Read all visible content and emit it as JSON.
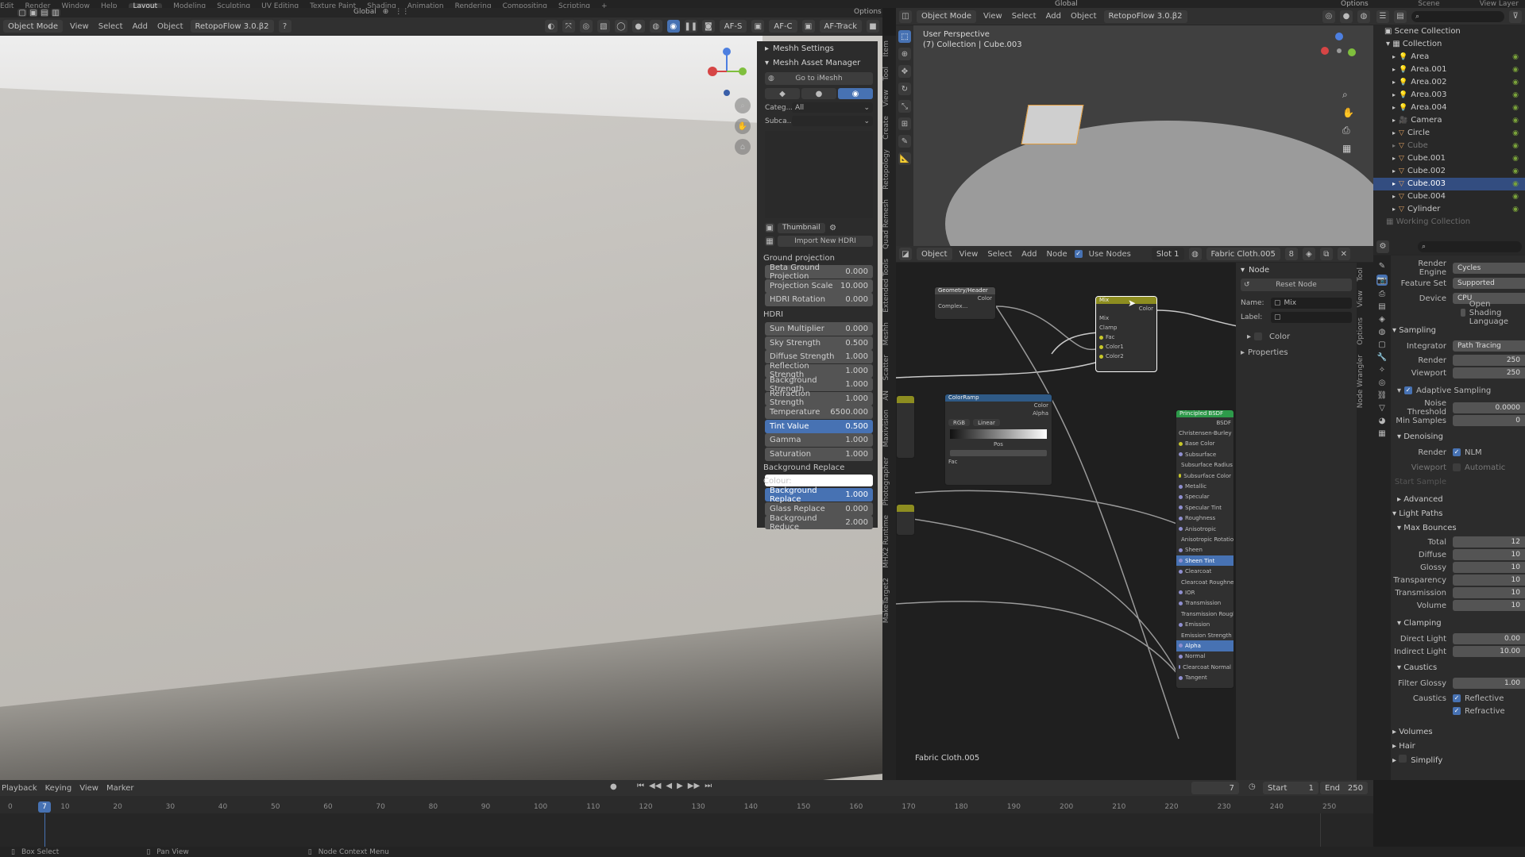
{
  "topbar": {
    "menus": [
      "Edit",
      "Render",
      "Window",
      "Help",
      "Layout",
      "Modeling",
      "Sculpting",
      "UV Editing",
      "Texture Paint",
      "Shading",
      "Animation",
      "Rendering",
      "Compositing",
      "Scripting",
      "+"
    ],
    "active": "Layout",
    "scene": "Scene",
    "view_layer": "View Layer"
  },
  "left_header": {
    "mode": "Object Mode",
    "menus": [
      "View",
      "Select",
      "Add",
      "Object"
    ],
    "addon": "RetopoFlow 3.0.β2",
    "orientation": "Global",
    "afs": "AF-S",
    "afc": "AF-C",
    "aftrack": "AF-Track",
    "options": "Options"
  },
  "meshh": {
    "settings_title": "Meshh Settings",
    "manager_title": "Meshh Asset Manager",
    "goto": "Go to iMeshh",
    "category_label": "Categ...",
    "category_value": "All",
    "subcategory_label": "Subca...",
    "thumbnail_label": "Thumbnail",
    "import_label": "Import New HDRI",
    "ground_title": "Ground projection",
    "ground_rows": [
      {
        "label": "Beta Ground Projection",
        "value": "0.000"
      },
      {
        "label": "Projection Scale",
        "value": "10.000"
      },
      {
        "label": "HDRI Rotation",
        "value": "0.000"
      }
    ],
    "hdri_title": "HDRI",
    "hdri_rows": [
      {
        "label": "Sun Multiplier",
        "value": "0.000"
      },
      {
        "label": "Sky Strength",
        "value": "0.500"
      },
      {
        "label": "Diffuse Strength",
        "value": "1.000"
      },
      {
        "label": "Reflection Strength",
        "value": "1.000"
      },
      {
        "label": "Background Strength",
        "value": "1.000"
      },
      {
        "label": "Refraction Strength",
        "value": "1.000"
      },
      {
        "label": "Temperature",
        "value": "6500.000"
      },
      {
        "label": "Tint Value",
        "value": "0.500"
      },
      {
        "label": "Gamma",
        "value": "1.000"
      },
      {
        "label": "Saturation",
        "value": "1.000"
      }
    ],
    "bg_colour_label": "Background Replace Colour:",
    "replace_rows": [
      {
        "label": "Background Replace",
        "value": "1.000"
      },
      {
        "label": "Glass Replace",
        "value": "0.000"
      },
      {
        "label": "Background Reduce",
        "value": "2.000"
      }
    ]
  },
  "vtabs_left": [
    "Item",
    "Tool",
    "View",
    "Create",
    "Retopology",
    "Quad Remesh",
    "Extended Tools",
    "Meshh",
    "Scatter",
    "AN",
    "Maxivision",
    "Photographer",
    "MHX2 Runtime",
    "MakeTarget2"
  ],
  "vp3d": {
    "perspective": "User Perspective",
    "collection": "(7) Collection | Cube.003",
    "mode": "Object Mode",
    "menus": [
      "View",
      "Select",
      "Add",
      "Object"
    ],
    "addon": "RetopoFlow 3.0.β2",
    "orientation": "Global",
    "options": "Options"
  },
  "node_editor": {
    "mode": "Object",
    "menus": [
      "View",
      "Select",
      "Add",
      "Node"
    ],
    "use_nodes": "Use Nodes",
    "slot": "Slot 1",
    "material": "Fabric Cloth.005",
    "users": "8",
    "footer_material": "Fabric Cloth.005",
    "node_panel_title": "Node",
    "reset_node": "Reset Node",
    "name_label": "Name:",
    "name_value": "Mix",
    "label_label": "Label:",
    "color_section": "Color",
    "properties_section": "Properties",
    "vtabs": [
      "Tool",
      "View",
      "Options",
      "Node Wrangler"
    ],
    "nodes": {
      "mix_title": "Mix",
      "mix_rows": [
        "Color",
        "Mix",
        "Clamp",
        "Fac",
        "Color1",
        "Color2"
      ],
      "ramp_title": "ColorRamp",
      "ramp_rows": [
        "Color",
        "Alpha",
        "RGB",
        "Linear",
        "Pos",
        "Fac"
      ],
      "bsdf_title": "Principled BSDF",
      "bsdf_rows": [
        "BSDF",
        "Christensen-Burley",
        "Base Color",
        "Subsurface",
        "Subsurface Radius",
        "Subsurface Color",
        "Metallic",
        "Specular",
        "Specular Tint",
        "Roughness",
        "Anisotropic",
        "Anisotropic Rotation",
        "Sheen",
        "Sheen Tint",
        "Clearcoat",
        "Clearcoat Roughness",
        "IOR",
        "Transmission",
        "Transmission Roughness",
        "Emission",
        "Emission Strength",
        "Alpha",
        "Normal",
        "Clearcoat Normal",
        "Tangent"
      ],
      "geo_title": "Geometry/Header",
      "geo_rows": [
        "Color",
        "Complex..."
      ]
    }
  },
  "outliner": {
    "root": "Scene Collection",
    "collection": "Collection",
    "items": [
      {
        "name": "Area",
        "kind": "light"
      },
      {
        "name": "Area.001",
        "kind": "light"
      },
      {
        "name": "Area.002",
        "kind": "light"
      },
      {
        "name": "Area.003",
        "kind": "light"
      },
      {
        "name": "Area.004",
        "kind": "light"
      },
      {
        "name": "Camera",
        "kind": "camera"
      },
      {
        "name": "Circle",
        "kind": "mesh"
      },
      {
        "name": "Cube",
        "kind": "mesh"
      },
      {
        "name": "Cube.001",
        "kind": "mesh"
      },
      {
        "name": "Cube.002",
        "kind": "mesh"
      },
      {
        "name": "Cube.003",
        "kind": "mesh"
      },
      {
        "name": "Cube.004",
        "kind": "mesh"
      },
      {
        "name": "Cylinder",
        "kind": "mesh"
      }
    ],
    "selected": "Cube.003",
    "working": "Working Collection"
  },
  "render_props": {
    "engine_label": "Render Engine",
    "engine": "Cycles",
    "feature_label": "Feature Set",
    "feature": "Supported",
    "device_label": "Device",
    "device": "CPU",
    "osl": "Open Shading Language",
    "sampling": "Sampling",
    "integrator_label": "Integrator",
    "integrator": "Path Tracing",
    "render_label": "Render",
    "render_val": "250",
    "viewport_label": "Viewport",
    "viewport_val": "250",
    "adaptive": "Adaptive Sampling",
    "noise_label": "Noise Threshold",
    "noise_val": "0.0000",
    "minsamp_label": "Min Samples",
    "minsamp_val": "0",
    "denoising": "Denoising",
    "dn_render_label": "Render",
    "dn_render_val": "NLM",
    "dn_viewport_label": "Viewport",
    "dn_viewport_val": "Automatic",
    "start_sample": "Start Sample",
    "advanced": "Advanced",
    "light_paths": "Light Paths",
    "max_bounces": "Max Bounces",
    "bounces": [
      {
        "label": "Total",
        "value": "12"
      },
      {
        "label": "Diffuse",
        "value": "10"
      },
      {
        "label": "Glossy",
        "value": "10"
      },
      {
        "label": "Transparency",
        "value": "10"
      },
      {
        "label": "Transmission",
        "value": "10"
      },
      {
        "label": "Volume",
        "value": "10"
      }
    ],
    "clamping": "Clamping",
    "direct_label": "Direct Light",
    "direct_val": "0.00",
    "indirect_label": "Indirect Light",
    "indirect_val": "10.00",
    "caustics": "Caustics",
    "filter_label": "Filter Glossy",
    "filter_val": "1.00",
    "caus_label": "Caustics",
    "reflective": "Reflective",
    "refractive": "Refractive",
    "volumes": "Volumes",
    "hair": "Hair",
    "simplify": "Simplify"
  },
  "timeline": {
    "menus": [
      "Playback",
      "Keying",
      "View",
      "Marker"
    ],
    "current": "7",
    "start_label": "Start",
    "start": "1",
    "end_label": "End",
    "end": "250",
    "ticks": [
      "0",
      "10",
      "20",
      "30",
      "40",
      "50",
      "60",
      "70",
      "80",
      "90",
      "100",
      "110",
      "120",
      "130",
      "140",
      "150",
      "160",
      "170",
      "180",
      "190",
      "200",
      "210",
      "220",
      "230",
      "240",
      "250"
    ]
  },
  "statusbar": {
    "box_select": "Box Select",
    "pan_view": "Pan View",
    "context_menu": "Node Context Menu"
  },
  "colors": {
    "accent": "#4772b3",
    "selected_row": "#334d80",
    "bsdf_header": "#2d9a4a",
    "mix_header": "#b9b92b",
    "ramp_header": "#3b6ea0"
  }
}
